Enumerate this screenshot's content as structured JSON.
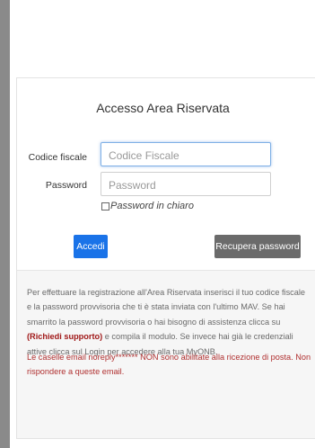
{
  "login": {
    "title": "Accesso Area Riservata",
    "codice_fiscale_label": "Codice fiscale",
    "codice_fiscale_placeholder": "Codice Fiscale",
    "password_label": "Password",
    "password_placeholder": "Password",
    "show_password_label": "Password in chiaro",
    "login_button": "Accedi",
    "recover_button": "Recupera password"
  },
  "info": {
    "line1": "Per effettuare la registrazione all'Area Riservata inserisci il tuo codice fiscale",
    "line2": "e la password provvisoria che ti è stata inviata con l'ultimo MAV. Se hai",
    "line3": "smarrito la password provvisoria o hai bisogno di assistenza clicca su",
    "support_link": "(Richiedi supporto)",
    "line4_rest": " e compila il modulo. Se invece hai già le credenziali",
    "line5": "attive clicca sul Login per accedere alla tua MyONB.",
    "notice_line1": "Le caselle email noreply******* NON sono abilitate alla ricezione di posta. Non",
    "notice_line2": "rispondere a queste email."
  },
  "colors": {
    "primary_button": "#1a73e8",
    "secondary_button": "#6b6b6b",
    "support_link": "#a01818",
    "notice_text": "#b03030"
  }
}
